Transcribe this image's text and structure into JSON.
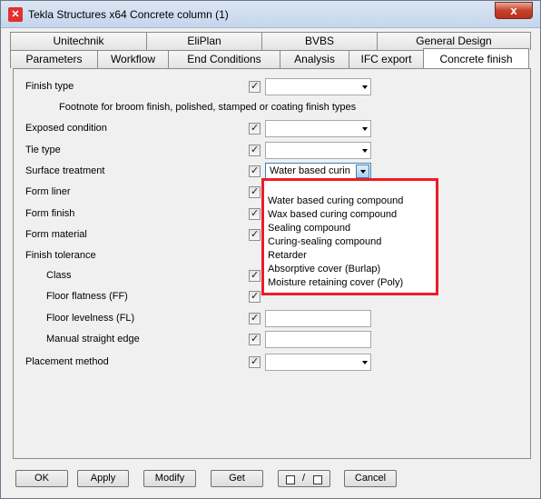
{
  "window": {
    "title": "Tekla Structures x64  Concrete column (1)",
    "app_icon": "tekla-logo-icon",
    "close_glyph": "x"
  },
  "tabs": {
    "row1": [
      "Unitechnik",
      "EliPlan",
      "BVBS",
      "General Design"
    ],
    "row2": [
      "Parameters",
      "Workflow",
      "End Conditions",
      "Analysis",
      "IFC export",
      "Concrete finish"
    ],
    "active": "Concrete finish"
  },
  "fields": {
    "finish_type": {
      "label": "Finish type",
      "value": ""
    },
    "footnote": "Footnote for broom finish, polished, stamped or coating finish types",
    "exposed_condition": {
      "label": "Exposed condition",
      "value": ""
    },
    "tie_type": {
      "label": "Tie type",
      "value": ""
    },
    "surface_treatment": {
      "label": "Surface treatment",
      "value": "Water based curin"
    },
    "form_liner": {
      "label": "Form liner"
    },
    "form_finish": {
      "label": "Form finish"
    },
    "form_material": {
      "label": "Form material"
    },
    "finish_tolerance": {
      "label": "Finish tolerance"
    },
    "class": {
      "label": "Class"
    },
    "floor_flatness": {
      "label": "Floor flatness (FF)",
      "value": ""
    },
    "floor_levelness": {
      "label": "Floor levelness (FL)",
      "value": ""
    },
    "manual_straight_edge": {
      "label": "Manual straight edge",
      "value": ""
    },
    "placement_method": {
      "label": "Placement method",
      "value": ""
    }
  },
  "dropdown": {
    "items": [
      "",
      "Water based curing compound",
      "Wax based curing compound",
      "Sealing compound",
      "Curing-sealing compound",
      "Retarder",
      "Absorptive cover (Burlap)",
      "Moisture retaining cover (Poly)"
    ],
    "highlight_color": "#ee1c24"
  },
  "buttons": {
    "ok": "OK",
    "apply": "Apply",
    "modify": "Modify",
    "get": "Get",
    "toggle_separator": "/",
    "cancel": "Cancel"
  }
}
